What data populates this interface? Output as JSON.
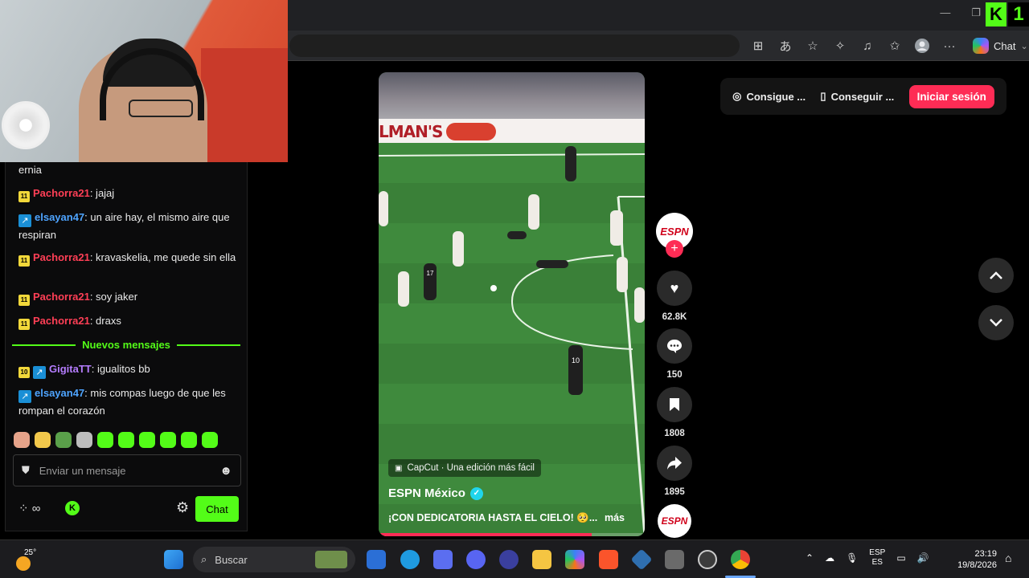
{
  "browser": {
    "chat_label": "Chat"
  },
  "chat": {
    "messages": [
      {
        "user": "",
        "text": "ernia"
      },
      {
        "user": "Pachorra21",
        "text": ": jajaj",
        "badge": "11"
      },
      {
        "user": "elsayan47",
        "text": ": un aire hay, el mismo aire que respiran",
        "badge": "↗"
      },
      {
        "user": "Pachorra21",
        "text": ": kravaskelia, me quede sin ella",
        "badge": "11"
      },
      {
        "user": "Pachorra21",
        "text": ": soy jaker",
        "badge": "11"
      },
      {
        "user": "Pachorra21",
        "text": ": draxs",
        "badge": "11"
      },
      {
        "user": "GigitaTT",
        "text": ": igualitos bb",
        "badge": "10"
      },
      {
        "user": "elsayan47",
        "text": ": mis compas luego de que les rompan el corazón",
        "badge": "↗"
      }
    ],
    "new_messages_label": "Nuevos mensajes",
    "input_placeholder": "Enviar un mensaje",
    "send_label": "Chat"
  },
  "video": {
    "ad_text": "LMAN'S",
    "capcut_text": "CapCut · Una edición más fácil",
    "author": "ESPN México",
    "description": "¡CON DEDICATORIA HASTA EL CIELO! 🥺...",
    "more_label": "más",
    "progress": 0.8,
    "player_numbers": [
      "17",
      "10"
    ]
  },
  "actions": {
    "avatar_label": "ESPN",
    "likes": "62.8K",
    "comments": "150",
    "saves": "1808",
    "shares": "1895"
  },
  "topbar": {
    "btn1": "Consigue ...",
    "btn2": "Conseguir ...",
    "login": "Iniciar sesión"
  },
  "taskbar": {
    "temperature": "25°",
    "search_label": "Buscar",
    "lang1": "ESP",
    "lang2": "ES",
    "time": "23:19",
    "date": "19/8/2026"
  },
  "colors": {
    "kick_green": "#53fc18",
    "tiktok_red": "#fe2c55",
    "username_red": "#ff3f56",
    "username_blue": "#4ea4ff",
    "username_purple": "#b57dff"
  }
}
